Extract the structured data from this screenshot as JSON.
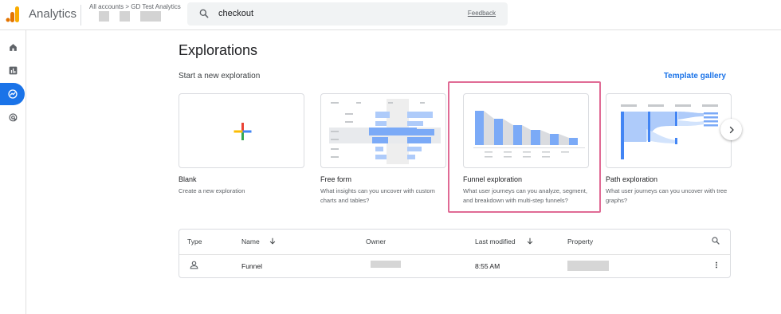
{
  "header": {
    "app_title": "Analytics",
    "breadcrumb": "All accounts > GD Test Analytics",
    "search_value": "checkout",
    "feedback_label": "Feedback",
    "logo_colors": [
      "#f9ab00",
      "#e37400"
    ]
  },
  "rail": {
    "items": [
      {
        "icon": "home-icon"
      },
      {
        "icon": "reports-icon"
      },
      {
        "icon": "explore-icon",
        "active": true
      },
      {
        "icon": "advertising-icon"
      }
    ],
    "accent": "#1a73e8"
  },
  "main": {
    "title": "Explorations",
    "subtitle": "Start a new exploration",
    "template_gallery_label": "Template gallery",
    "cards": [
      {
        "title": "Blank",
        "desc": "Create a new exploration"
      },
      {
        "title": "Free form",
        "desc": "What insights can you uncover with custom charts and tables?"
      },
      {
        "title": "Funnel exploration",
        "desc": "What user journeys can you analyze, segment, and breakdown with multi-step funnels?",
        "highlighted": true
      },
      {
        "title": "Path exploration",
        "desc": "What user journeys can you uncover with tree graphs?"
      }
    ],
    "highlight_color": "#e06b95"
  },
  "table": {
    "headers": {
      "type": "Type",
      "name": "Name",
      "owner": "Owner",
      "last_modified": "Last modified",
      "property": "Property"
    },
    "rows": [
      {
        "name": "Funnel",
        "last_modified": "8:55 AM"
      }
    ]
  }
}
